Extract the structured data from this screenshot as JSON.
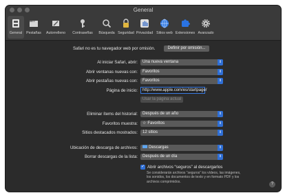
{
  "window": {
    "title": "General"
  },
  "toolbar": {
    "tabs": [
      {
        "label": "General",
        "icon": "switch-icon"
      },
      {
        "label": "Pestañas",
        "icon": "tabs-icon"
      },
      {
        "label": "Autorrelleno",
        "icon": "pencil-icon"
      },
      {
        "label": "Contraseñas",
        "icon": "key-icon"
      },
      {
        "label": "Búsqueda",
        "icon": "search-icon"
      },
      {
        "label": "Seguridad",
        "icon": "lock-icon"
      },
      {
        "label": "Privacidad",
        "icon": "hand-icon"
      },
      {
        "label": "Sitios web",
        "icon": "globe-icon"
      },
      {
        "label": "Extensiones",
        "icon": "puzzle-icon"
      },
      {
        "label": "Avanzado",
        "icon": "gear-icon"
      }
    ],
    "active_tab": "General"
  },
  "default_browser": {
    "text": "Safari no es tu navegador web por omisión.",
    "button_label": "Definir por omisión..."
  },
  "settings": {
    "startup_label": "Al iniciar Safari, abrir:",
    "startup_value": "Una nueva ventana",
    "new_windows_label": "Abrir ventanas nuevas con:",
    "new_windows_value": "Favoritos",
    "new_tabs_label": "Abrir pestañas nuevas con:",
    "new_tabs_value": "Favoritos",
    "homepage_label": "Página de inicio:",
    "homepage_value": "http://www.apple.com/es/startpage/",
    "use_current_page_label": "Usar la página actual",
    "remove_history_label": "Eliminar ítems del historial:",
    "remove_history_value": "Después de un año",
    "favorites_shows_label": "Favoritos muestra:",
    "favorites_shows_value": "Favoritos",
    "top_sites_label": "Sitios destacados mostrados:",
    "top_sites_value": "12 sitios",
    "download_location_label": "Ubicación de descarga de archivos:",
    "download_location_value": "Descargas",
    "remove_downloads_label": "Borrar descargas de la lista:",
    "remove_downloads_value": "Después de un día",
    "open_safe_files_label": "Abrir archivos “seguros” al descargarlos",
    "open_safe_files_note": "Se considerarán archivos “seguros” los vídeos, las imágenes, los sonidos, los documentos de texto y en formato PDF y los archivos comprimidos.",
    "open_safe_files_checked": true
  },
  "help": {
    "label": "?"
  },
  "colors": {
    "accent": "#2f6fd6",
    "window_bg": "#2b2b2b",
    "toolbar_bg": "#3a3a3a"
  }
}
